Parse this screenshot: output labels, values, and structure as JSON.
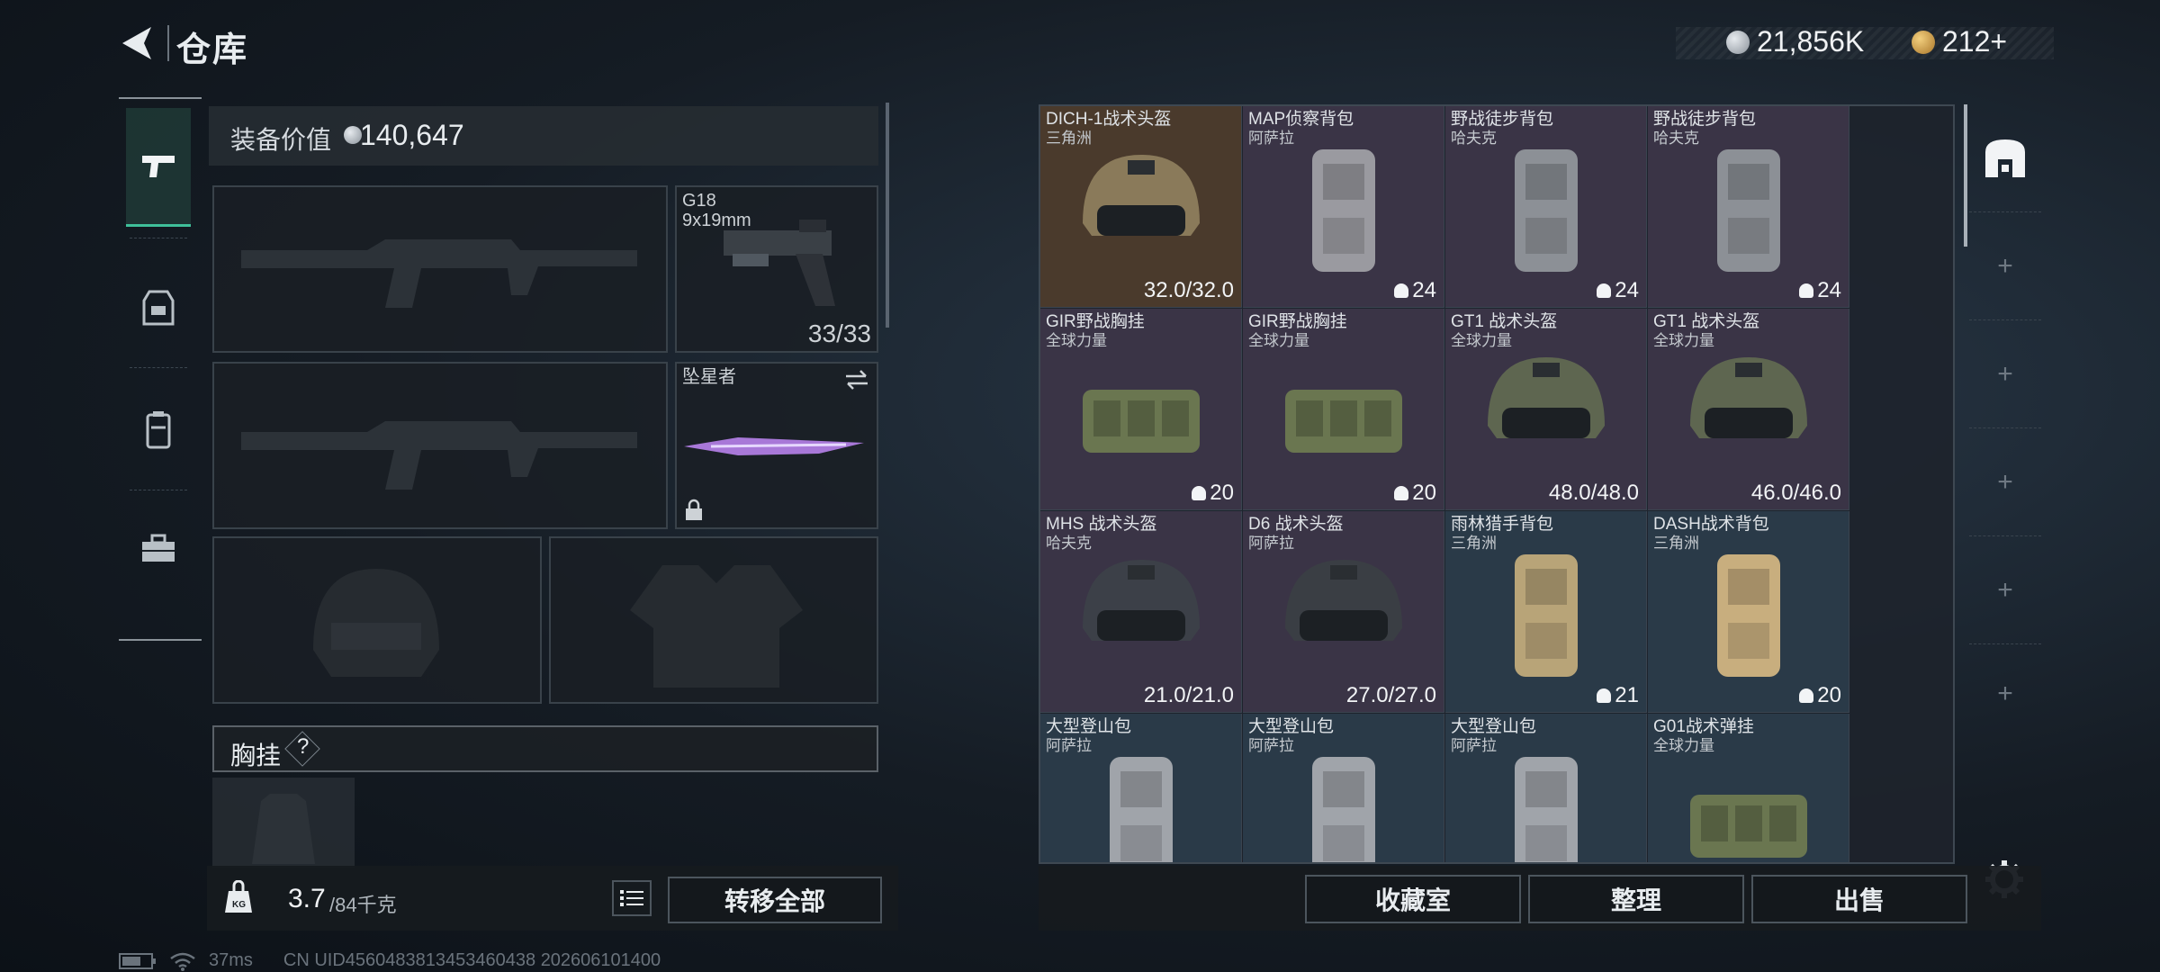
{
  "header": {
    "title": "仓库"
  },
  "currency": [
    {
      "value": "21,856K",
      "color": "#b9c0c8"
    },
    {
      "value": "212+",
      "color": "#d8a64a"
    }
  ],
  "equipment": {
    "value_label": "装备价值",
    "value": "140,647",
    "sidearm": {
      "name": "G18",
      "ammo": "9x19mm",
      "count": "33/33"
    },
    "melee": {
      "name": "坠星者"
    },
    "chest_rig_label": "胸挂",
    "help": "?"
  },
  "weight": {
    "current": "3.7",
    "capacity": "/84千克"
  },
  "buttons": {
    "transfer_all": "转移全部",
    "collection": "收藏室",
    "organize": "整理",
    "sell": "出售"
  },
  "inventory": [
    {
      "name": "DICH-1战术头盔",
      "sub": "三角洲",
      "val": "32.0/32.0",
      "type": "helmet",
      "bg": "#4a3a2c",
      "tint": "#8a7a5a"
    },
    {
      "name": "MAP侦察背包",
      "sub": "阿萨拉",
      "cap": "24",
      "type": "backpack",
      "bg": "#3a3446",
      "tint": "#9a9aa0"
    },
    {
      "name": "野战徒步背包",
      "sub": "哈夫克",
      "cap": "24",
      "type": "backpack",
      "bg": "#3a3446",
      "tint": "#8c9096"
    },
    {
      "name": "野战徒步背包",
      "sub": "哈夫克",
      "cap": "24",
      "type": "backpack",
      "bg": "#3a3446",
      "tint": "#8c9096"
    },
    {
      "name": "GIR野战胸挂",
      "sub": "全球力量",
      "cap": "20",
      "type": "rig",
      "bg": "#3a3446",
      "tint": "#6a7650"
    },
    {
      "name": "GIR野战胸挂",
      "sub": "全球力量",
      "cap": "20",
      "type": "rig",
      "bg": "#3a3446",
      "tint": "#6a7650"
    },
    {
      "name": "GT1 战术头盔",
      "sub": "全球力量",
      "val": "48.0/48.0",
      "type": "helmet",
      "bg": "#3a3446",
      "tint": "#5e6650"
    },
    {
      "name": "GT1 战术头盔",
      "sub": "全球力量",
      "val": "46.0/46.0",
      "type": "helmet",
      "bg": "#3a3446",
      "tint": "#5e6650"
    },
    {
      "name": "MHS 战术头盔",
      "sub": "哈夫克",
      "val": "21.0/21.0",
      "type": "helmet",
      "bg": "#3a3446",
      "tint": "#3c4048"
    },
    {
      "name": "D6 战术头盔",
      "sub": "阿萨拉",
      "val": "27.0/27.0",
      "type": "helmet",
      "bg": "#3a3446",
      "tint": "#3a3e44"
    },
    {
      "name": "雨林猎手背包",
      "sub": "三角洲",
      "cap": "21",
      "type": "backpack",
      "bg": "#2a3a48",
      "tint": "#b8a478"
    },
    {
      "name": "DASH战术背包",
      "sub": "三角洲",
      "cap": "20",
      "type": "backpack",
      "bg": "#2a3a48",
      "tint": "#c8ae7e"
    },
    {
      "name": "大型登山包",
      "sub": "阿萨拉",
      "type": "backpack",
      "bg": "#2a3a48",
      "tint": "#a0a4aa"
    },
    {
      "name": "大型登山包",
      "sub": "阿萨拉",
      "type": "backpack",
      "bg": "#2a3a48",
      "tint": "#a0a4aa"
    },
    {
      "name": "大型登山包",
      "sub": "阿萨拉",
      "type": "backpack",
      "bg": "#2a3a48",
      "tint": "#a0a4aa"
    },
    {
      "name": "G01战术弹挂",
      "sub": "全球力量",
      "type": "rig",
      "bg": "#2a3a48",
      "tint": "#6a7650"
    }
  ],
  "status_bar": {
    "ping": "37ms",
    "uid": "CN UID4560483813453460438 202606101400"
  }
}
